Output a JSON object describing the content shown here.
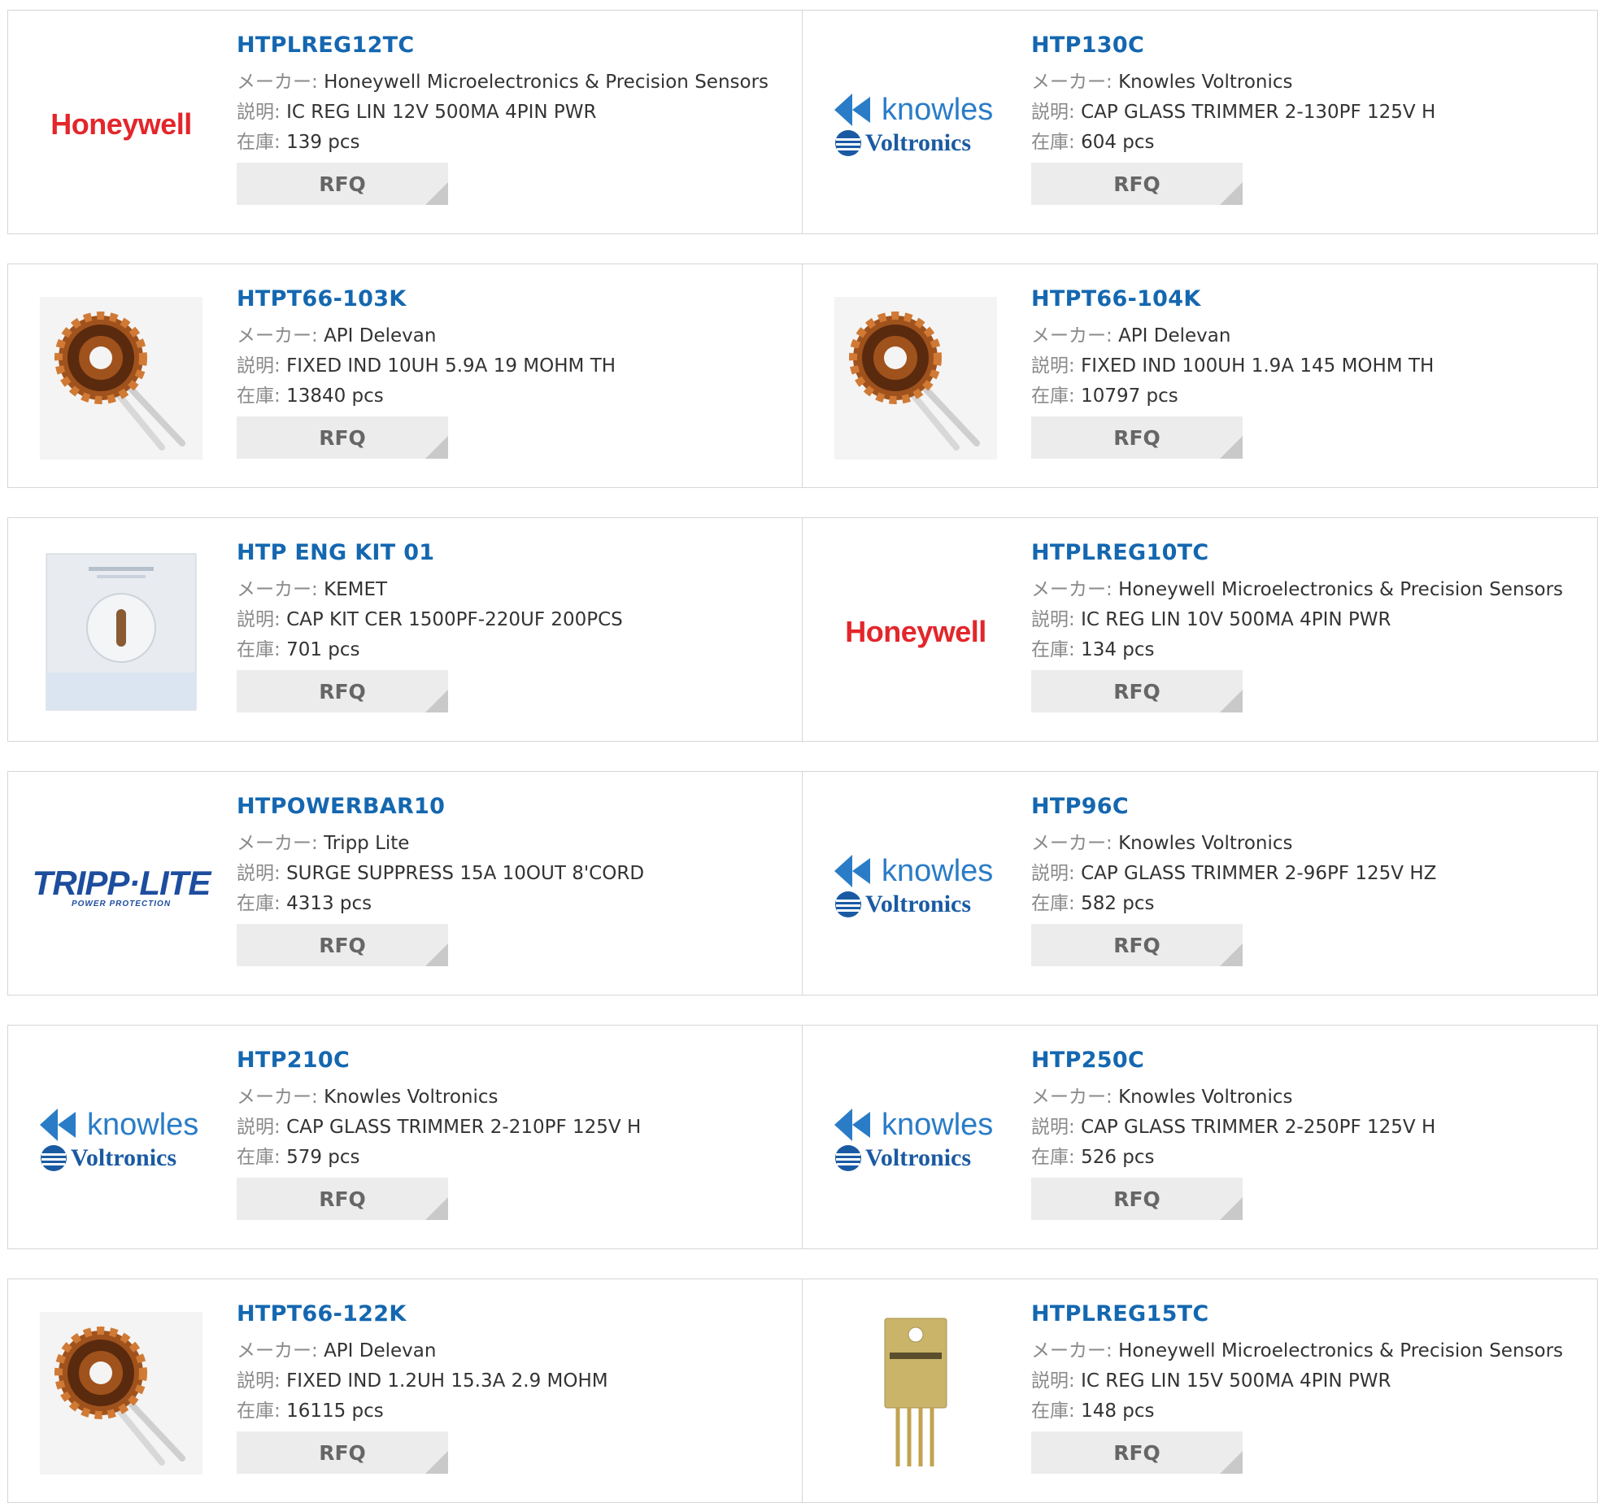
{
  "labels": {
    "maker": "メーカー:",
    "desc": "説明:",
    "stock": "在庫:",
    "rfq": "RFQ"
  },
  "products": [
    {
      "name": "HTPLREG12TC",
      "maker": "Honeywell Microelectronics & Precision Sensors",
      "desc": "IC REG LIN 12V 500MA 4PIN PWR",
      "stock": "139 pcs",
      "image": "honeywell-logo"
    },
    {
      "name": "HTP130C",
      "maker": "Knowles Voltronics",
      "desc": "CAP GLASS TRIMMER 2-130PF 125V H",
      "stock": "604 pcs",
      "image": "knowles-voltronics-logo"
    },
    {
      "name": "HTPT66-103K",
      "maker": "API Delevan",
      "desc": "FIXED IND 10UH 5.9A 19 MOHM TH",
      "stock": "13840 pcs",
      "image": "toroid-inductor"
    },
    {
      "name": "HTPT66-104K",
      "maker": "API Delevan",
      "desc": "FIXED IND 100UH 1.9A 145 MOHM TH",
      "stock": "10797 pcs",
      "image": "toroid-inductor"
    },
    {
      "name": "HTP ENG KIT 01",
      "maker": "KEMET",
      "desc": "CAP KIT CER 1500PF-220UF 200PCS",
      "stock": "701 pcs",
      "image": "kit-box"
    },
    {
      "name": "HTPLREG10TC",
      "maker": "Honeywell Microelectronics & Precision Sensors",
      "desc": "IC REG LIN 10V 500MA 4PIN PWR",
      "stock": "134 pcs",
      "image": "honeywell-logo"
    },
    {
      "name": "HTPOWERBAR10",
      "maker": "Tripp Lite",
      "desc": "SURGE SUPPRESS 15A 10OUT 8'CORD",
      "stock": "4313 pcs",
      "image": "tripp-lite-logo"
    },
    {
      "name": "HTP96C",
      "maker": "Knowles Voltronics",
      "desc": "CAP GLASS TRIMMER 2-96PF 125V HZ",
      "stock": "582 pcs",
      "image": "knowles-voltronics-logo"
    },
    {
      "name": "HTP210C",
      "maker": "Knowles Voltronics",
      "desc": "CAP GLASS TRIMMER 2-210PF 125V H",
      "stock": "579 pcs",
      "image": "knowles-voltronics-logo"
    },
    {
      "name": "HTP250C",
      "maker": "Knowles Voltronics",
      "desc": "CAP GLASS TRIMMER 2-250PF 125V H",
      "stock": "526 pcs",
      "image": "knowles-voltronics-logo"
    },
    {
      "name": "HTPT66-122K",
      "maker": "API Delevan",
      "desc": "FIXED IND 1.2UH 15.3A 2.9 MOHM",
      "stock": "16115 pcs",
      "image": "toroid-inductor"
    },
    {
      "name": "HTPLREG15TC",
      "maker": "Honeywell Microelectronics & Precision Sensors",
      "desc": "IC REG LIN 15V 500MA 4PIN PWR",
      "stock": "148 pcs",
      "image": "to220-package"
    }
  ],
  "logos": {
    "honeywell": "Honeywell",
    "knowles": "knowles",
    "voltronics": "Voltronics",
    "tripp_main": "TRIPP·LITE",
    "tripp_sub": "POWER PROTECTION"
  },
  "colors": {
    "link": "#1467b0",
    "label": "#8a8a8a",
    "honeywell": "#e3262b",
    "knowles": "#2a7cc7",
    "tripp": "#1d4d9e",
    "rfq_bg": "#ececec"
  }
}
